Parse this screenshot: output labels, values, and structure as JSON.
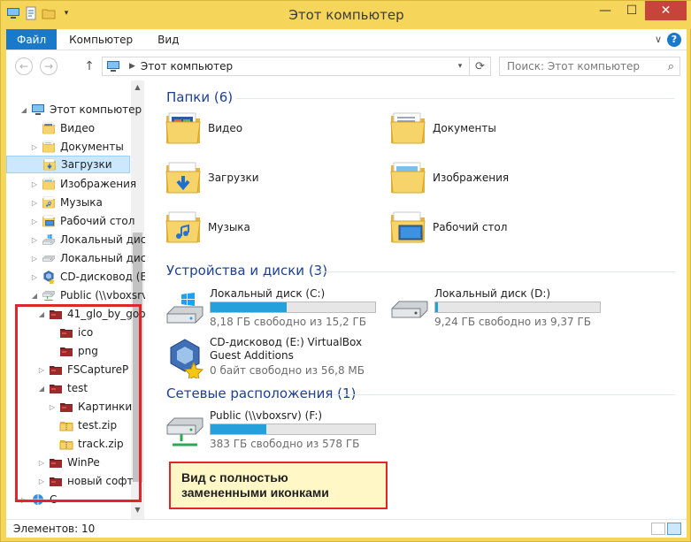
{
  "window": {
    "title": "Этот компьютер",
    "minimize": "—",
    "maximize": "☐",
    "close": "✕"
  },
  "ribbon": {
    "tabs": [
      "Файл",
      "Компьютер",
      "Вид"
    ],
    "collapse": "∨",
    "help": "?"
  },
  "address": {
    "back": "←",
    "forward": "→",
    "up": "↑",
    "crumb_arrow": "▶",
    "location": "Этот компьютер",
    "dropdown": "▾",
    "refresh": "⟳",
    "search_placeholder": "Поиск: Этот компьютер",
    "search_icon": "⌕"
  },
  "nav_tree": [
    {
      "label": "Этот компьютер",
      "icon": "computer-icon",
      "exp": "◢",
      "selected": false
    },
    {
      "label": "Видео",
      "icon": "video-folder-icon",
      "exp": "",
      "selected": false
    },
    {
      "label": "Документы",
      "icon": "documents-folder-icon",
      "exp": "▷",
      "selected": false
    },
    {
      "label": "Загрузки",
      "icon": "downloads-folder-icon",
      "exp": "",
      "selected": true
    },
    {
      "label": "Изображения",
      "icon": "pictures-folder-icon",
      "exp": "▷",
      "selected": false
    },
    {
      "label": "Музыка",
      "icon": "music-folder-icon",
      "exp": "▷",
      "selected": false
    },
    {
      "label": "Рабочий стол",
      "icon": "desktop-folder-icon",
      "exp": "▷",
      "selected": false
    },
    {
      "label": "Локальный диск",
      "icon": "windows-drive-icon",
      "exp": "▷",
      "selected": false
    },
    {
      "label": "Локальный диск",
      "icon": "drive-icon",
      "exp": "▷",
      "selected": false
    },
    {
      "label": "CD-дисковод (E:",
      "icon": "cd-drive-icon",
      "exp": "▷",
      "selected": false
    },
    {
      "label": "Public (\\\\vboxsrv",
      "icon": "network-drive-icon",
      "exp": "◢",
      "selected": false
    },
    {
      "label": "41_glo_by_goo",
      "icon": "custom-folder-icon",
      "exp": "◢",
      "selected": false
    },
    {
      "label": "ico",
      "icon": "custom-folder-icon",
      "exp": "",
      "selected": false
    },
    {
      "label": "png",
      "icon": "custom-folder-icon",
      "exp": "",
      "selected": false
    },
    {
      "label": "FSCaptureP",
      "icon": "custom-folder-icon",
      "exp": "▷",
      "selected": false
    },
    {
      "label": "test",
      "icon": "custom-folder-icon",
      "exp": "◢",
      "selected": false
    },
    {
      "label": "Картинки",
      "icon": "custom-folder-icon",
      "exp": "▷",
      "selected": false
    },
    {
      "label": "test.zip",
      "icon": "zip-folder-icon",
      "exp": "",
      "selected": false
    },
    {
      "label": "track.zip",
      "icon": "zip-folder-icon",
      "exp": "",
      "selected": false
    },
    {
      "label": "WinPe",
      "icon": "custom-folder-icon",
      "exp": "▷",
      "selected": false
    },
    {
      "label": "новый софт",
      "icon": "custom-folder-icon",
      "exp": "▷",
      "selected": false
    },
    {
      "label": "С",
      "icon": "network-icon",
      "exp": "▷",
      "selected": false
    }
  ],
  "groups": {
    "folders": {
      "title": "Папки (6)",
      "items": [
        {
          "label": "Видео",
          "icon": "video-folder-icon"
        },
        {
          "label": "Документы",
          "icon": "documents-folder-icon"
        },
        {
          "label": "Загрузки",
          "icon": "downloads-folder-icon"
        },
        {
          "label": "Изображения",
          "icon": "pictures-folder-icon"
        },
        {
          "label": "Музыка",
          "icon": "music-folder-icon"
        },
        {
          "label": "Рабочий стол",
          "icon": "desktop-folder-icon"
        }
      ]
    },
    "devices": {
      "title": "Устройства и диски (3)",
      "items": [
        {
          "name": "Локальный диск (C:)",
          "free": "8,18 ГБ свободно из 15,2 ГБ",
          "used_fraction": 0.46,
          "icon": "windows-drive-icon"
        },
        {
          "name": "Локальный диск (D:)",
          "free": "9,24 ГБ свободно из 9,37 ГБ",
          "used_fraction": 0.014,
          "icon": "drive-icon"
        },
        {
          "name": "CD-дисковод (E:) VirtualBox Guest Additions",
          "free": "0 байт свободно из 56,8 МБ",
          "icon": "cd-drive-icon"
        }
      ]
    },
    "network": {
      "title": "Сетевые расположения (1)",
      "items": [
        {
          "name": "Public (\\\\vboxsrv) (F:)",
          "free": "383 ГБ свободно из 578 ГБ",
          "used_fraction": 0.34,
          "icon": "network-drive-icon"
        }
      ]
    }
  },
  "callout": {
    "line1": "Вид с полностью",
    "line2": "замененными иконками"
  },
  "status": {
    "items_count": "Элементов: 10"
  },
  "colors": {
    "title_bar": "#f6d65a",
    "file_tab": "#1979ca",
    "group_header": "#1e3f8f",
    "drive_bar": "#26a0da",
    "highlight_border": "#e0262a"
  }
}
